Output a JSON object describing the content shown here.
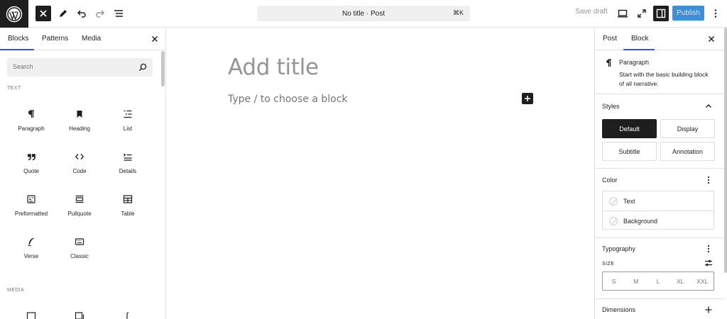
{
  "topbar": {
    "logo_icon": "wordpress-logo",
    "close_inserter_icon": "close-icon",
    "tools_icon": "pencil-icon",
    "undo_icon": "undo-icon",
    "redo_icon": "redo-icon",
    "document_overview_icon": "list-view-icon",
    "command_title": "No title · Post",
    "command_shortcut": "⌘K",
    "save_draft": "Save draft",
    "preview_icon": "desktop-icon",
    "fullscreen_icon": "fullscreen-icon",
    "settings_icon": "sidebar-icon",
    "publish": "Publish",
    "options_icon": "more-vertical-icon",
    "publish_color": "#3d8fd6"
  },
  "inserter": {
    "tabs": [
      "Blocks",
      "Patterns",
      "Media"
    ],
    "active_tab": "Blocks",
    "search_placeholder": "Search",
    "categories": {
      "text": "TEXT",
      "media": "MEDIA"
    },
    "blocks": [
      {
        "label": "Paragraph",
        "icon": "paragraph-icon"
      },
      {
        "label": "Heading",
        "icon": "heading-icon"
      },
      {
        "label": "List",
        "icon": "list-icon"
      },
      {
        "label": "Quote",
        "icon": "quote-icon"
      },
      {
        "label": "Code",
        "icon": "code-icon"
      },
      {
        "label": "Details",
        "icon": "details-icon"
      },
      {
        "label": "Preformatted",
        "icon": "preformatted-icon"
      },
      {
        "label": "Pullquote",
        "icon": "pullquote-icon"
      },
      {
        "label": "Table",
        "icon": "table-icon"
      },
      {
        "label": "Verse",
        "icon": "verse-icon"
      },
      {
        "label": "Classic",
        "icon": "classic-icon"
      }
    ]
  },
  "canvas": {
    "title_placeholder": "Add title",
    "paragraph_placeholder": "Type / to choose a block"
  },
  "sidebar": {
    "tabs": [
      "Post",
      "Block"
    ],
    "active_tab": "Block",
    "block_card": {
      "title": "Paragraph",
      "description": "Start with the basic building block of all narrative."
    },
    "styles": {
      "heading": "Styles",
      "options": [
        "Default",
        "Display",
        "Subtitle",
        "Annotation"
      ],
      "active": "Default"
    },
    "color": {
      "heading": "Color",
      "items": [
        "Text",
        "Background"
      ]
    },
    "typography": {
      "heading": "Typography",
      "size_label": "SIZE",
      "sizes": [
        "S",
        "M",
        "L",
        "XL",
        "XXL"
      ]
    },
    "dimensions": {
      "heading": "Dimensions"
    }
  }
}
